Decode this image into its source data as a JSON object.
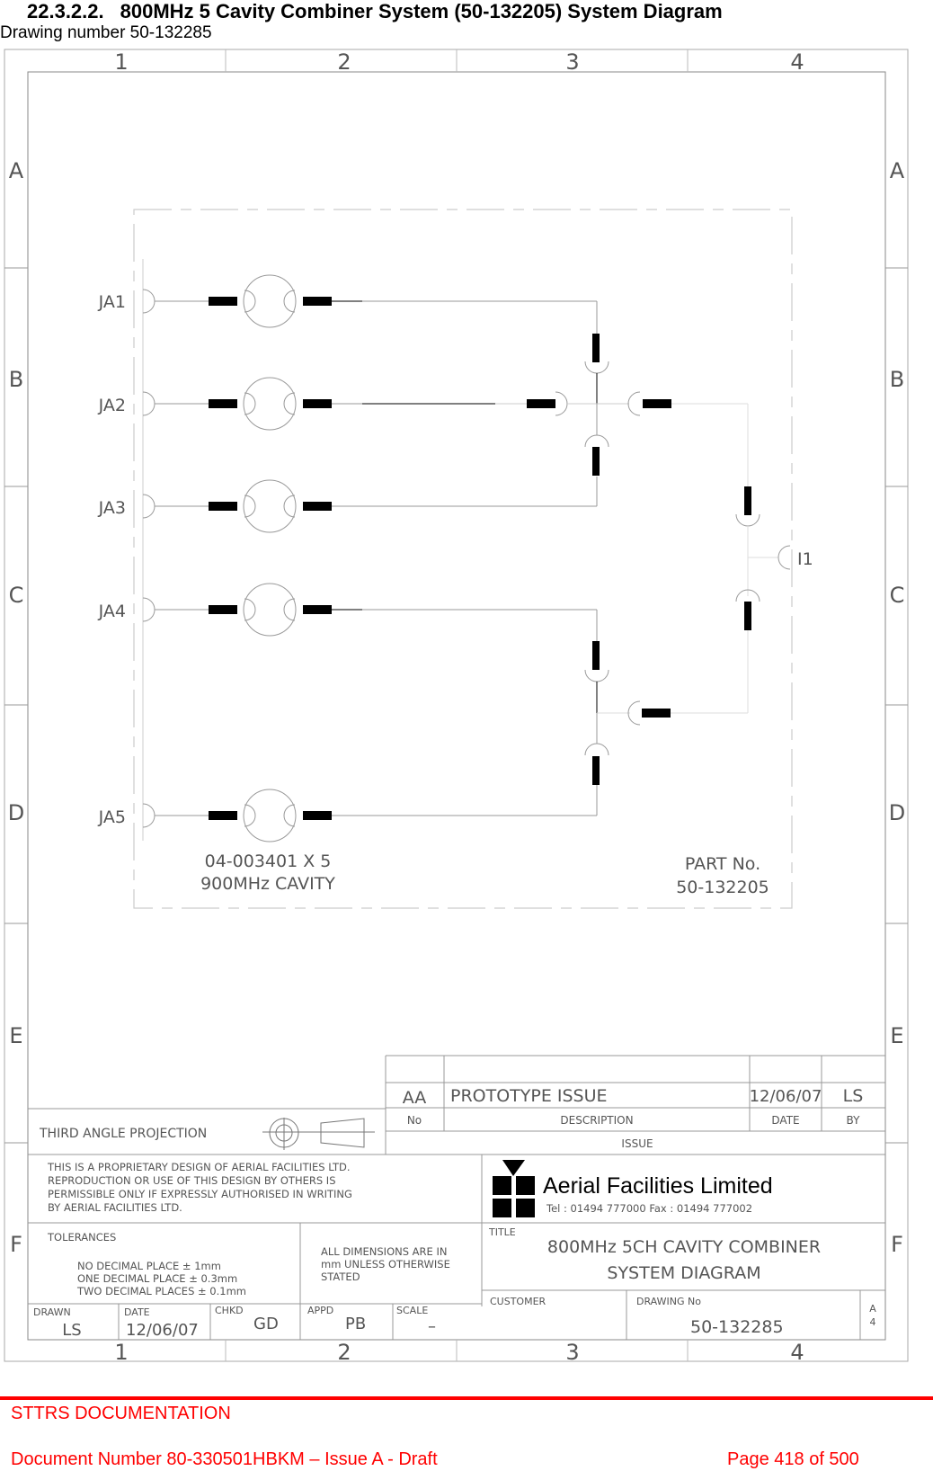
{
  "header": {
    "section_number": "22.3.2.2.",
    "section_title": "800MHz 5 Cavity Combiner System (50-132205) System Diagram",
    "drawing_caption": "Drawing number 50-132285"
  },
  "drawing": {
    "grid": {
      "columns": [
        "1",
        "2",
        "3",
        "4"
      ],
      "rows": [
        "A",
        "B",
        "C",
        "D",
        "E",
        "F"
      ]
    },
    "inputs": [
      {
        "label": "JA1"
      },
      {
        "label": "JA2"
      },
      {
        "label": "JA3"
      },
      {
        "label": "JA4"
      },
      {
        "label": "JA5"
      }
    ],
    "output": {
      "label": "I1"
    },
    "cavity_note": {
      "line1": "04-003401 X 5",
      "line2": "900MHz CAVITY"
    },
    "part_note": {
      "line1": "PART No.",
      "line2": "50-132205"
    },
    "title_block": {
      "revision_table": {
        "rows": [
          {
            "no": "",
            "description": "",
            "date": "",
            "by": ""
          },
          {
            "no": "AA",
            "description": "PROTOTYPE ISSUE",
            "date": "12/06/07",
            "by": "LS"
          }
        ],
        "headers": {
          "no": "No",
          "description": "DESCRIPTION",
          "date": "DATE",
          "by": "BY"
        },
        "footer": "ISSUE"
      },
      "projection": "THIRD ANGLE PROJECTION",
      "proprietary": [
        "THIS IS A PROPRIETARY DESIGN OF AERIAL FACILITIES LTD.",
        "REPRODUCTION OR USE OF THIS DESIGN BY OTHERS IS",
        "PERMISSIBLE ONLY IF EXPRESSLY AUTHORISED IN WRITING",
        "BY AERIAL FACILITIES LTD."
      ],
      "company": {
        "name": "Aerial Facilities Limited",
        "contact": "Tel : 01494 777000 Fax : 01494 777002"
      },
      "tolerances": {
        "label": "TOLERANCES",
        "lines": [
          "NO DECIMAL PLACE ± 1mm",
          "ONE DECIMAL PLACE ± 0.3mm",
          "TWO DECIMAL PLACES ± 0.1mm"
        ]
      },
      "dimensions_note": [
        "ALL DIMENSIONS ARE IN",
        "mm UNLESS OTHERWISE",
        "STATED"
      ],
      "title_label": "TITLE",
      "title_lines": [
        "800MHz 5CH CAVITY COMBINER",
        "SYSTEM DIAGRAM"
      ],
      "drawn": {
        "label": "DRAWN",
        "value": "LS"
      },
      "date": {
        "label": "DATE",
        "value": "12/06/07"
      },
      "chkd": {
        "label": "CHKD",
        "value": "GD"
      },
      "appd": {
        "label": "APPD",
        "value": "PB"
      },
      "scale": {
        "label": "SCALE",
        "value": "–"
      },
      "customer": {
        "label": "CUSTOMER",
        "value": ""
      },
      "drawing_no": {
        "label": "DRAWING No",
        "value": "50-132285"
      },
      "sheet_size": [
        "A",
        "4"
      ]
    }
  },
  "footer": {
    "title": "STTRS DOCUMENTATION",
    "document": "Document Number 80-330501HBKM – Issue A - Draft",
    "page": "Page 418 of 500"
  }
}
